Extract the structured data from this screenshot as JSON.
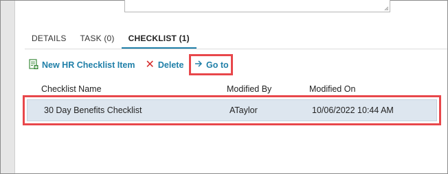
{
  "tabs": [
    {
      "label": "DETAILS"
    },
    {
      "label": "TASK (0)"
    },
    {
      "label": "CHECKLIST (1)"
    }
  ],
  "active_tab": 2,
  "toolbar": {
    "new_label": "New HR Checklist Item",
    "delete_label": "Delete",
    "goto_label": "Go to"
  },
  "table": {
    "columns": [
      "Checklist Name",
      "Modified By",
      "Modified On"
    ],
    "rows": [
      {
        "name": "30 Day Benefits Checklist",
        "modified_by": "ATaylor",
        "modified_on": "10/06/2022 10:44 AM"
      }
    ]
  },
  "colors": {
    "accent": "#1f7fa8",
    "highlight_box": "#e8474b",
    "delete_icon": "#d42a2a",
    "selected_row": "#dde6ef"
  },
  "icons": [
    "resize-grip-icon",
    "new-checklist-icon",
    "delete-x-icon",
    "arrow-right-icon"
  ]
}
